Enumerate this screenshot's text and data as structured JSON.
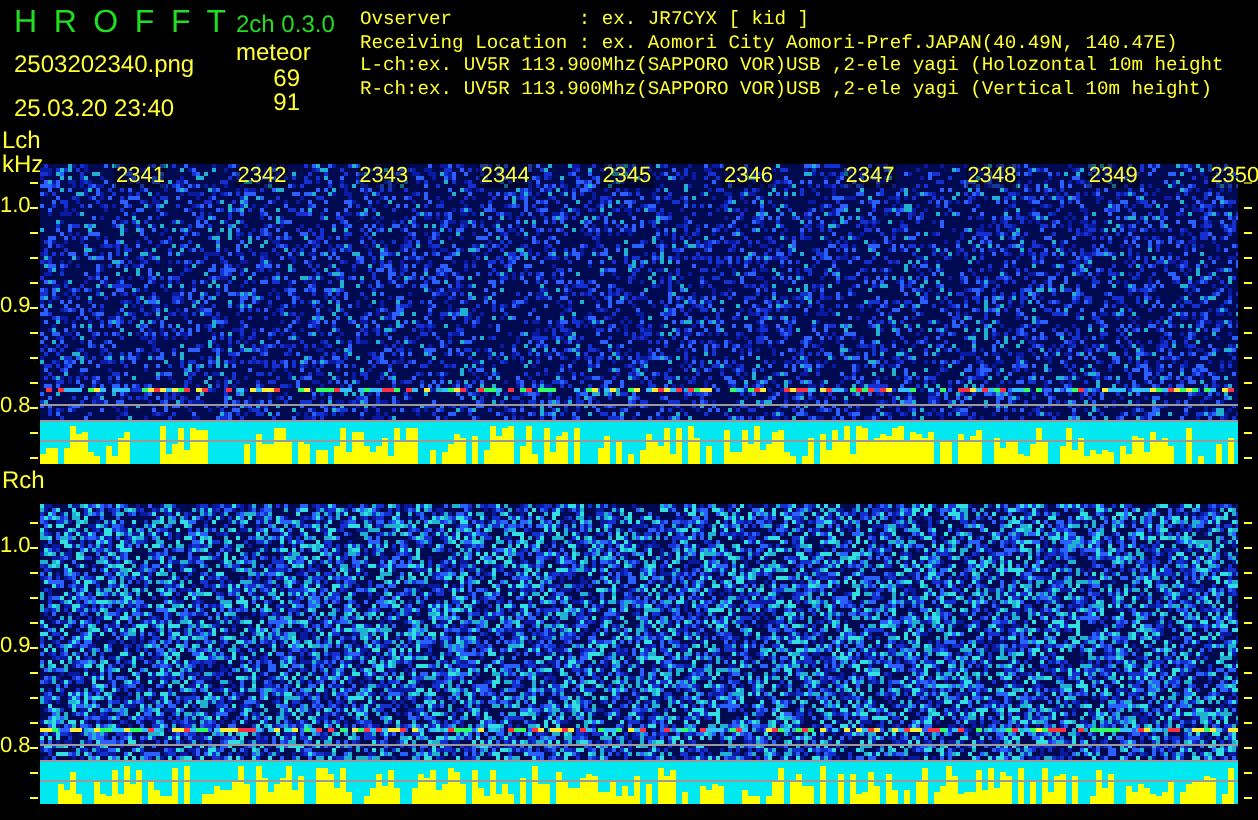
{
  "app": {
    "title": "H R O F F T",
    "version": "2ch 0.3.0",
    "filename": "2503202340.png",
    "datetime": "25.03.20 23:40"
  },
  "meteor": {
    "label": "meteor",
    "counts": [
      "69",
      "91"
    ]
  },
  "info": [
    "Ovserver           : ex. JR7CYX [ kid ]",
    "Receiving Location : ex. Aomori City Aomori-Pref.JAPAN(40.49N, 140.47E)",
    "L-ch:ex. UV5R 113.900Mhz(SAPPORO VOR)USB ,2-ele yagi (Holozontal 10m height",
    "R-ch:ex. UV5R 113.900Mhz(SAPPORO VOR)USB ,2-ele yagi (Vertical 10m height)"
  ],
  "channels": [
    {
      "label": "Lch",
      "unit": "kHz",
      "time_ticks": [
        "2341",
        "2342",
        "2343",
        "2344",
        "2345",
        "2346",
        "2347",
        "2348",
        "2349",
        "2350"
      ],
      "freq_ticks": [
        "1.0",
        "0.9",
        "0.8"
      ]
    },
    {
      "label": "Rch",
      "freq_ticks": [
        "1.0",
        "0.9",
        "0.8"
      ]
    }
  ]
}
